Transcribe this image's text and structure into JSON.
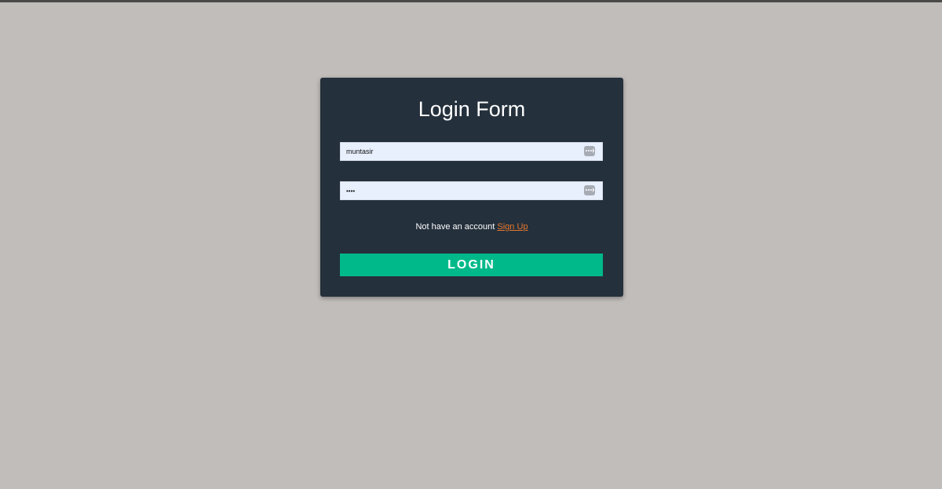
{
  "form": {
    "title": "Login Form",
    "username": {
      "value": "muntasir",
      "icon": "password-manager-key-icon"
    },
    "password": {
      "value": "••••",
      "icon": "password-manager-key-icon"
    },
    "signup_prompt": "Not have an account",
    "signup_link": "Sign Up",
    "login_button": "LOGIN"
  },
  "colors": {
    "page_background": "#c1bdba",
    "card_background": "#24303c",
    "input_background": "#e8f0fe",
    "link": "#e8782e",
    "button": "#00b98a"
  }
}
